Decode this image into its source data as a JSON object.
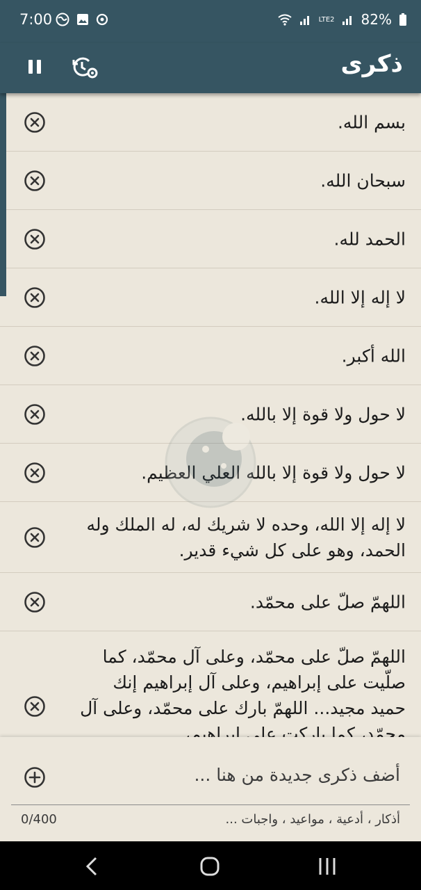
{
  "status": {
    "time": "7:00",
    "battery": "82%",
    "network": "LTE2"
  },
  "app": {
    "title": "ذكرى"
  },
  "items": [
    {
      "text": "بسم الله."
    },
    {
      "text": "سبحان الله."
    },
    {
      "text": "الحمد لله."
    },
    {
      "text": "لا إله إلا الله."
    },
    {
      "text": "الله أكبر."
    },
    {
      "text": "لا حول ولا قوة إلا بالله."
    },
    {
      "text": "لا حول ولا قوة إلا بالله العلي العظيم."
    },
    {
      "text": "لا إله إلا الله، وحده لا شريك له، له الملك وله الحمد، وهو على كل شيء قدير."
    },
    {
      "text": "اللهمّ صلّ على محمّد."
    },
    {
      "text": "اللهمّ صلّ على محمّد، وعلى آل محمّد، كما صلّيت على إبراهيم، وعلى آل إبراهيم إنك حميد مجيد... اللهمّ بارك على محمّد، وعلى آل محمّد، كما باركت على إبراهيم،"
    }
  ],
  "composer": {
    "placeholder": "أضف ذكرى جديدة من هنا ...",
    "hint": "أذكار ، أدعية ، مواعيد ، واجبات ...",
    "counter": "0/400"
  },
  "colors": {
    "primary": "#365562",
    "background": "#ece7dc"
  }
}
